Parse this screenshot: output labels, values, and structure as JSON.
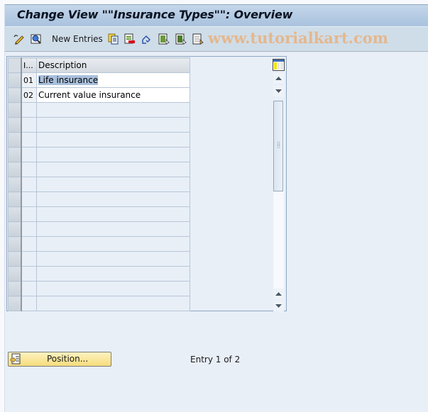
{
  "window": {
    "title": "Change View \"\"Insurance Types\"\": Overview"
  },
  "toolbar": {
    "buttons": [
      {
        "icon": "display-change-icon",
        "label": ""
      },
      {
        "icon": "details-icon",
        "label": ""
      },
      {
        "icon": "new-entries-text",
        "label": "New Entries"
      },
      {
        "icon": "copy-as-icon",
        "label": ""
      },
      {
        "icon": "delete-icon",
        "label": ""
      },
      {
        "icon": "undo-change-icon",
        "label": ""
      },
      {
        "icon": "select-all-icon",
        "label": ""
      },
      {
        "icon": "select-block-icon",
        "label": ""
      },
      {
        "icon": "deselect-all-icon",
        "label": ""
      }
    ],
    "new_entries_label": "New Entries",
    "watermark": "www.tutorialkart.com"
  },
  "table": {
    "columns": [
      {
        "key": "id",
        "label": "I..."
      },
      {
        "key": "description",
        "label": "Description"
      }
    ],
    "rows": [
      {
        "id": "01",
        "description": "Life insurance",
        "highlighted": true
      },
      {
        "id": "02",
        "description": "Current value insurance",
        "highlighted": false
      },
      {
        "id": "",
        "description": ""
      },
      {
        "id": "",
        "description": ""
      },
      {
        "id": "",
        "description": ""
      },
      {
        "id": "",
        "description": ""
      },
      {
        "id": "",
        "description": ""
      },
      {
        "id": "",
        "description": ""
      },
      {
        "id": "",
        "description": ""
      },
      {
        "id": "",
        "description": ""
      },
      {
        "id": "",
        "description": ""
      },
      {
        "id": "",
        "description": ""
      },
      {
        "id": "",
        "description": ""
      },
      {
        "id": "",
        "description": ""
      },
      {
        "id": "",
        "description": ""
      },
      {
        "id": "",
        "description": ""
      }
    ]
  },
  "footer": {
    "position_button_label": "Position...",
    "entry_status": "Entry 1 of 2"
  },
  "colors": {
    "titlebar": "#b4c9e2",
    "toolbar": "#cfdde9",
    "background": "#e8eff7",
    "selection": "#a9c0dc",
    "position_button": "#f8e59a",
    "watermark": "#e8b384"
  }
}
